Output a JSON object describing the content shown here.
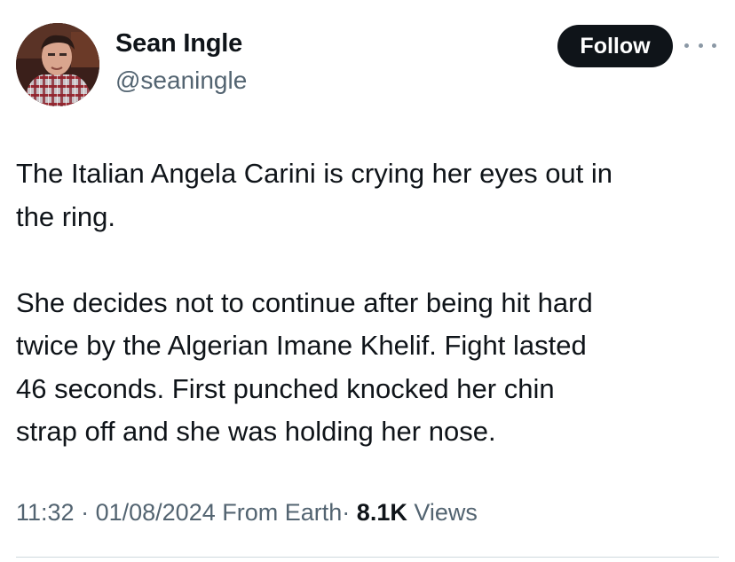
{
  "author": {
    "display_name": "Sean Ingle",
    "handle": "@seaningle",
    "avatar_icon": "profile-photo"
  },
  "follow_button": {
    "label": "Follow"
  },
  "more_menu": {
    "icon": "more-horizontal-icon"
  },
  "tweet": {
    "paragraphs": [
      "The Italian Angela Carini is crying her eyes out in\nthe ring.",
      "She decides not to continue after being hit hard\ntwice by the Algerian Imane Khelif. Fight lasted\n46 seconds. First punched knocked her chin\nstrap off and she was holding her nose."
    ]
  },
  "meta": {
    "time": "11:32",
    "separator": "·",
    "date": "01/08/2024",
    "source": "From Earth",
    "views_count": "8.1K",
    "views_label": "Views"
  },
  "colors": {
    "text_primary": "#0f1419",
    "text_secondary": "#536471",
    "follow_bg": "#0f1419",
    "follow_text": "#ffffff",
    "divider": "#cfd9de"
  }
}
